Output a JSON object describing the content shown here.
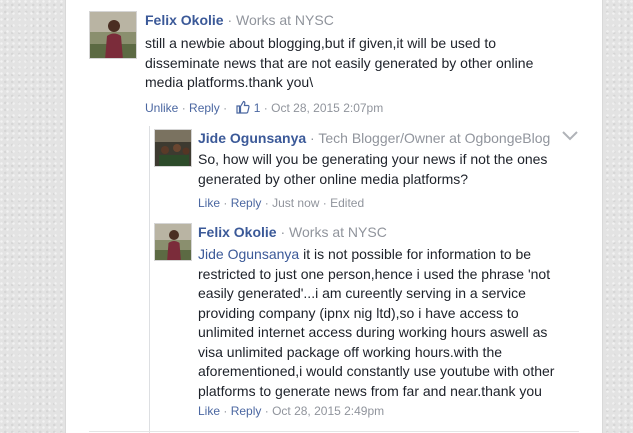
{
  "comments": [
    {
      "author": "Felix Okolie",
      "separator": "·",
      "subtitle": "Works at NYSC",
      "text": "still a newbie about blogging,but if given,it will be used to disseminate news that are not easily generated by other online media platforms.thank you\\",
      "actions": {
        "unlike": "Unlike",
        "reply": "Reply",
        "like_count": "1",
        "timestamp": "Oct 28, 2015 2:07pm"
      }
    }
  ],
  "replies": [
    {
      "author": "Jide Ogunsanya",
      "separator": "·",
      "subtitle": "Tech Blogger/Owner at OgbongeBlog",
      "text": "So, how will you be generating your news if not the ones generated by other online media platforms?",
      "actions": {
        "like": "Like",
        "reply": "Reply",
        "timestamp": "Just now",
        "edited": "Edited"
      }
    },
    {
      "author": "Felix Okolie",
      "separator": "·",
      "subtitle": "Works at NYSC",
      "mention": "Jide Ogunsanya",
      "text": " it is not possible for information to be restricted to just one person,hence i used the phrase 'not easily generated'...i am cureently serving in a service providing company (ipnx nig ltd),so i have access to unlimited internet access during working hours aswell as visa unlimited package off working hours.with the aforementioned,i would constantly use youtube with other platforms to generate news from far and near.thank you",
      "actions": {
        "like": "Like",
        "reply": "Reply",
        "timestamp": "Oct 28, 2015 2:49pm"
      }
    }
  ],
  "icons": [
    "thumbs-up-icon",
    "chevron-down-icon"
  ],
  "colors": {
    "author": "#3b5998",
    "link": "#4b67a1",
    "muted": "#90949c",
    "text": "#1d2129"
  }
}
